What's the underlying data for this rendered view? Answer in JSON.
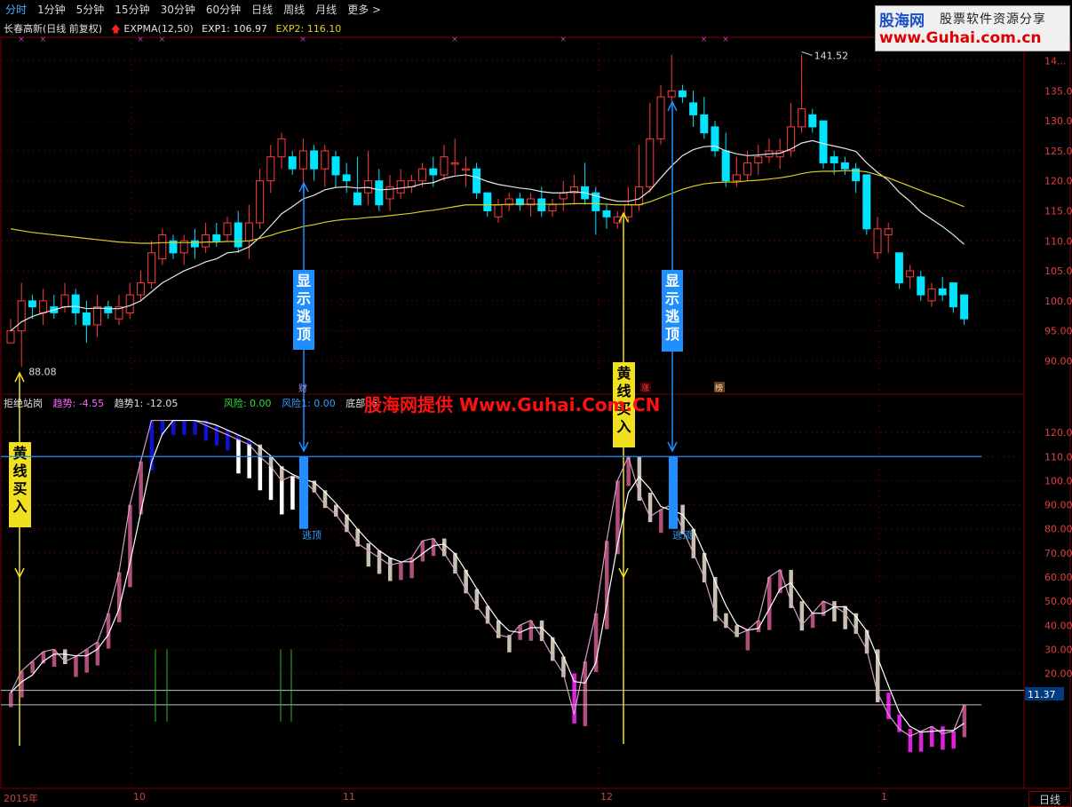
{
  "tabs": [
    {
      "label": "分时",
      "active": true
    },
    {
      "label": "1分钟",
      "active": false
    },
    {
      "label": "5分钟",
      "active": false
    },
    {
      "label": "15分钟",
      "active": false
    },
    {
      "label": "30分钟",
      "active": false
    },
    {
      "label": "60分钟",
      "active": false
    },
    {
      "label": "日线",
      "active": false
    },
    {
      "label": "周线",
      "active": false
    },
    {
      "label": "月线",
      "active": false
    },
    {
      "label": "更多 >",
      "active": false
    }
  ],
  "price_panel": {
    "stock_title": "长春高新(日线 前复权)",
    "indicator": "EXPMA(12,50)",
    "exp1": "EXP1: 106.97",
    "exp2": "EXP2: 116.10",
    "high_label": "141.52",
    "low_label": "88.08",
    "y_ticks": [
      "90.00",
      "95.00",
      "100.0",
      "105.0",
      "110.0",
      "115.0",
      "120.0",
      "125.0",
      "130.0",
      "135.0",
      "14..."
    ],
    "annot_cai": "财",
    "annot_zhang": "涨",
    "annot_bang": "榜",
    "annot_top1": "显示逃顶",
    "annot_top2": "显示逃顶"
  },
  "indicator_panel": {
    "name": "拒绝站岗",
    "trend": "趋势: -4.55",
    "trend1": "趋势1: -12.05",
    "risk": "风险: 0.00",
    "risk1": "风险1: 0.00",
    "bottom": "底部: 5",
    "y_ticks": [
      "20.00",
      "30.00",
      "40.00",
      "50.00",
      "60.00",
      "70.00",
      "80.00",
      "90.00",
      "100.0",
      "110.0",
      "120.0"
    ],
    "current_value": "11.37",
    "escape_label1": "逃顶",
    "escape_label2": "逃顶",
    "yellow_buy1": "黄线买入",
    "yellow_buy2": "黄线买入"
  },
  "logo": {
    "line1": "股海网",
    "line2": "股票软件资源分享",
    "line3": "www.Guhai.com.cn"
  },
  "watermark": "股海网提供 Www.Guhai.Com.CN",
  "dates": [
    "2015年",
    "10",
    "11",
    "12",
    "1"
  ],
  "right_tab": "日线",
  "colors": {
    "up": "#ff3b3b",
    "down": "#00e5ff",
    "exp1": "#e8e8e8",
    "exp2": "#d8d020",
    "grid": "#7a0000"
  },
  "chart_data": {
    "type": "candlestick",
    "candles": [
      [
        93,
        95,
        97,
        93
      ],
      [
        95,
        100,
        103,
        89
      ],
      [
        100,
        99,
        101,
        97
      ],
      [
        98,
        100,
        102,
        96
      ],
      [
        99,
        98,
        101,
        97
      ],
      [
        99,
        101,
        103,
        98
      ],
      [
        101,
        98,
        102,
        96
      ],
      [
        98,
        96,
        100,
        93
      ],
      [
        96,
        99,
        101,
        94
      ],
      [
        99,
        98,
        100,
        97
      ],
      [
        97,
        99,
        101,
        96
      ],
      [
        98,
        101,
        103,
        97
      ],
      [
        101,
        103,
        105,
        100
      ],
      [
        103,
        108,
        110,
        102
      ],
      [
        107,
        111,
        112,
        106
      ],
      [
        110,
        108,
        111,
        107
      ],
      [
        108,
        110,
        111,
        106
      ],
      [
        110,
        109,
        112,
        107
      ],
      [
        109,
        111,
        113,
        108
      ],
      [
        111,
        110,
        113,
        109
      ],
      [
        111,
        113,
        114,
        110
      ],
      [
        113,
        109,
        115,
        108
      ],
      [
        110,
        113,
        116,
        107
      ],
      [
        113,
        120,
        122,
        112
      ],
      [
        120,
        124,
        126,
        118
      ],
      [
        124,
        127,
        128,
        122
      ],
      [
        124,
        122,
        125,
        121
      ],
      [
        122,
        125,
        127,
        118
      ],
      [
        125,
        122,
        126,
        120
      ],
      [
        122,
        125,
        126,
        119
      ],
      [
        124,
        121,
        125,
        119
      ],
      [
        121,
        120,
        123,
        118
      ],
      [
        118,
        116,
        124,
        117
      ],
      [
        118,
        120,
        125,
        116
      ],
      [
        120,
        116,
        122,
        115
      ],
      [
        117,
        119,
        121,
        115
      ],
      [
        118,
        120,
        122,
        117
      ],
      [
        119,
        120,
        121,
        118
      ],
      [
        120,
        122,
        123,
        119
      ],
      [
        122,
        121,
        124,
        119
      ],
      [
        121,
        124,
        126,
        120
      ],
      [
        123,
        123,
        127,
        121
      ],
      [
        122,
        122,
        124,
        119
      ],
      [
        122,
        118,
        123,
        117
      ],
      [
        118,
        115,
        118,
        114
      ],
      [
        114,
        116,
        117,
        113
      ],
      [
        116,
        117,
        118,
        115
      ],
      [
        117,
        116,
        118,
        115
      ],
      [
        116,
        117,
        118,
        114
      ],
      [
        117,
        115,
        119,
        114
      ],
      [
        115,
        116,
        117,
        114
      ],
      [
        117,
        118,
        120,
        115
      ],
      [
        118,
        119,
        121,
        116
      ],
      [
        119,
        117,
        123,
        116
      ],
      [
        118,
        115,
        119,
        111
      ],
      [
        115,
        114,
        116,
        112
      ],
      [
        113,
        114,
        115,
        112
      ],
      [
        114,
        116,
        119,
        113
      ],
      [
        116,
        119,
        126,
        115
      ],
      [
        119,
        127,
        133,
        118
      ],
      [
        127,
        134,
        136,
        126
      ],
      [
        134,
        135,
        141,
        133
      ],
      [
        135,
        134,
        136,
        133
      ],
      [
        133,
        131,
        135,
        129
      ],
      [
        131,
        128,
        134,
        127
      ],
      [
        129,
        125,
        130,
        124
      ],
      [
        125,
        120,
        128,
        119
      ],
      [
        120,
        121,
        124,
        119
      ],
      [
        121,
        123,
        125,
        120
      ],
      [
        123,
        124,
        126,
        121
      ],
      [
        124,
        125,
        127,
        123
      ],
      [
        124,
        125,
        127,
        122
      ],
      [
        125,
        129,
        133,
        124
      ],
      [
        129,
        132,
        141,
        128
      ],
      [
        131,
        129,
        132,
        128
      ],
      [
        130,
        123,
        130,
        122
      ],
      [
        124,
        123,
        125,
        121
      ],
      [
        123,
        122,
        124,
        121
      ],
      [
        122,
        120,
        123,
        118
      ],
      [
        121,
        112,
        121,
        111
      ],
      [
        108,
        112,
        114,
        107
      ],
      [
        111,
        112,
        113,
        108
      ],
      [
        108,
        103,
        108,
        102
      ],
      [
        104,
        105,
        106,
        102
      ],
      [
        104,
        101,
        105,
        100
      ],
      [
        100,
        102,
        103,
        99
      ],
      [
        102,
        101,
        104,
        100
      ],
      [
        103,
        99,
        103,
        98
      ],
      [
        101,
        97,
        101,
        96
      ]
    ],
    "exp1": [
      95,
      96.5,
      97.4,
      98,
      98.5,
      99,
      99.1,
      98.7,
      98.8,
      98.7,
      98.7,
      99.2,
      100,
      101.5,
      103,
      104,
      105,
      105.7,
      106.5,
      107,
      108,
      108.2,
      109,
      110.6,
      112.5,
      114.5,
      115.7,
      117,
      117.6,
      118.5,
      118.9,
      119,
      118.8,
      118.9,
      118.5,
      118.6,
      118.8,
      119,
      119.5,
      119.7,
      120.4,
      120.8,
      121,
      120.6,
      119.9,
      119.4,
      119.1,
      118.8,
      118.6,
      118.2,
      118,
      118,
      118.2,
      118,
      117.5,
      117,
      116.6,
      116.6,
      117,
      118.4,
      120.5,
      122.5,
      124.2,
      125.2,
      125.7,
      125.8,
      125,
      124.5,
      124.2,
      124.3,
      124.5,
      124.6,
      125.3,
      126.3,
      126.7,
      126.2,
      125.8,
      125.4,
      124.9,
      123,
      121.4,
      120.1,
      118.1,
      116.6,
      114.8,
      113.6,
      112.4,
      111,
      109.4
    ],
    "exp2": [
      112,
      111.7,
      111.4,
      111.2,
      111,
      110.8,
      110.6,
      110.4,
      110.2,
      110,
      109.8,
      109.7,
      109.6,
      109.6,
      109.7,
      109.7,
      109.7,
      109.7,
      109.8,
      109.8,
      109.9,
      109.9,
      110,
      110.4,
      110.9,
      111.5,
      111.9,
      112.4,
      112.7,
      113.1,
      113.4,
      113.6,
      113.7,
      113.9,
      114,
      114.2,
      114.4,
      114.6,
      114.9,
      115.1,
      115.4,
      115.7,
      116,
      116,
      116,
      116,
      116.1,
      116.1,
      116.1,
      116.1,
      116.1,
      116.1,
      116.2,
      116.2,
      116.2,
      116.1,
      116,
      116,
      116,
      116.5,
      117.2,
      117.9,
      118.6,
      119.1,
      119.5,
      119.7,
      119.8,
      119.8,
      120,
      120.1,
      120.3,
      120.5,
      120.8,
      121.2,
      121.5,
      121.6,
      121.6,
      121.7,
      121.7,
      121.5,
      121,
      120.5,
      119.8,
      119.1,
      118.4,
      117.7,
      117.1,
      116.4,
      115.7
    ],
    "indicator": [
      12,
      21,
      25,
      29,
      30,
      25,
      27,
      30,
      33,
      45,
      62,
      90,
      108,
      125,
      125,
      125,
      125,
      125,
      123,
      121,
      119,
      117,
      115,
      110,
      106,
      100,
      102,
      100,
      96,
      90,
      86,
      80,
      74,
      71,
      68,
      65,
      66,
      68,
      75,
      76,
      70,
      63,
      55,
      48,
      42,
      36,
      35,
      40,
      42,
      35,
      27,
      20,
      3,
      25,
      45,
      75,
      100,
      110,
      95,
      85,
      88,
      90,
      80,
      70,
      60,
      45,
      40,
      36,
      38,
      42,
      60,
      63,
      50,
      40,
      45,
      50,
      48,
      45,
      38,
      30,
      12,
      3,
      -3,
      -6,
      -4,
      -2,
      -5,
      -4,
      7
    ]
  }
}
